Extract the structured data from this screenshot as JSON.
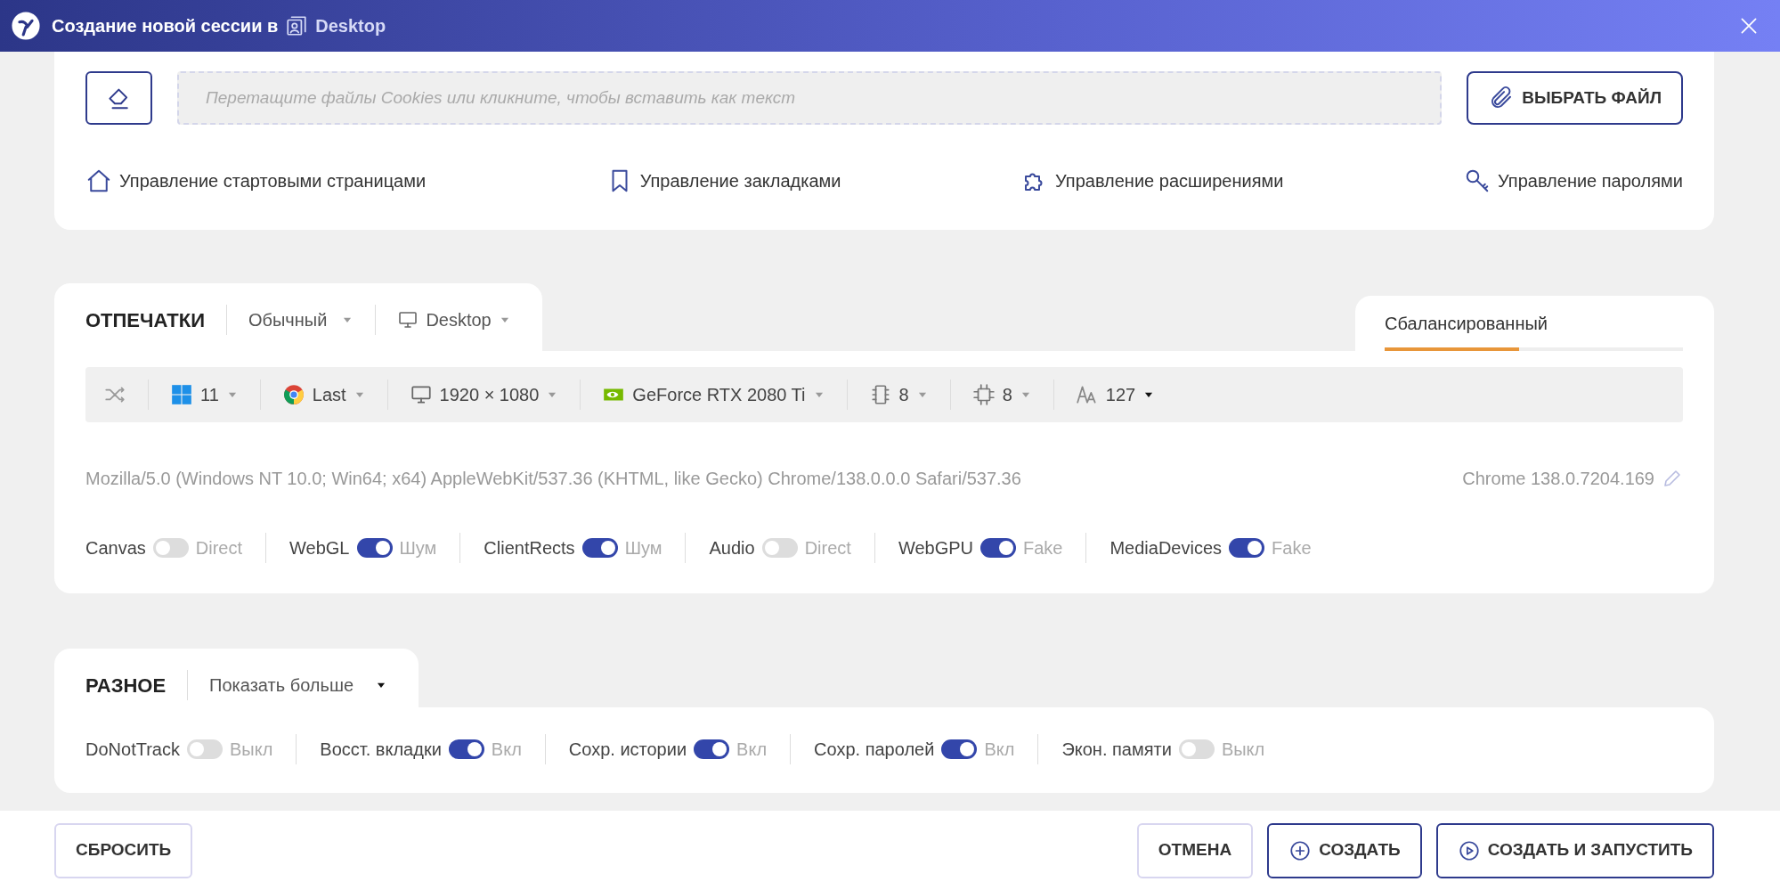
{
  "window": {
    "title": "Создание новой сессии в",
    "profile": "Desktop"
  },
  "cookies": {
    "placeholder": "Перетащите файлы Cookies или кликните, чтобы вставить как текст",
    "choose_button": "ВЫБРАТЬ ФАЙЛ"
  },
  "manage_links": [
    {
      "label": "Управление стартовыми страницами"
    },
    {
      "label": "Управление закладками"
    },
    {
      "label": "Управление расширениями"
    },
    {
      "label": "Управление паролями"
    }
  ],
  "fingerprints": {
    "title": "ОТПЕЧАТКИ",
    "mode": "Обычный",
    "device": "Desktop",
    "profile_meter": {
      "label": "Сбалансированный",
      "level": 0.45
    },
    "toolbar": [
      {
        "kind": "shuffle"
      },
      {
        "kind": "os",
        "value": "11"
      },
      {
        "kind": "browser",
        "value": "Last"
      },
      {
        "kind": "screen",
        "value": "1920 × 1080"
      },
      {
        "kind": "gpu",
        "value": "GeForce RTX 2080 Ti"
      },
      {
        "kind": "memory",
        "value": "8"
      },
      {
        "kind": "cpu",
        "value": "8"
      },
      {
        "kind": "fonts",
        "value": "127"
      }
    ],
    "user_agent": "Mozilla/5.0 (Windows NT 10.0; Win64; x64) AppleWebKit/537.36 (KHTML, like Gecko) Chrome/138.0.0.0 Safari/537.36",
    "browser_version": "Chrome 138.0.7204.169",
    "toggles": [
      {
        "label": "Canvas",
        "on": false,
        "state": "Direct"
      },
      {
        "label": "WebGL",
        "on": true,
        "state": "Шум"
      },
      {
        "label": "ClientRects",
        "on": true,
        "state": "Шум"
      },
      {
        "label": "Audio",
        "on": false,
        "state": "Direct"
      },
      {
        "label": "WebGPU",
        "on": true,
        "state": "Fake"
      },
      {
        "label": "MediaDevices",
        "on": true,
        "state": "Fake"
      }
    ]
  },
  "misc": {
    "title": "РАЗНОЕ",
    "more": "Показать больше",
    "toggles": [
      {
        "label": "DoNotTrack",
        "on": false,
        "state": "Выкл"
      },
      {
        "label": "Восст. вкладки",
        "on": true,
        "state": "Вкл"
      },
      {
        "label": "Сохр. истории",
        "on": true,
        "state": "Вкл"
      },
      {
        "label": "Сохр. паролей",
        "on": true,
        "state": "Вкл"
      },
      {
        "label": "Экон. памяти",
        "on": false,
        "state": "Выкл"
      }
    ]
  },
  "footer": {
    "reset": "СБРОСИТЬ",
    "cancel": "ОТМЕНА",
    "create": "СОЗДАТЬ",
    "create_run": "СОЗДАТЬ И ЗАПУСТИТЬ"
  }
}
